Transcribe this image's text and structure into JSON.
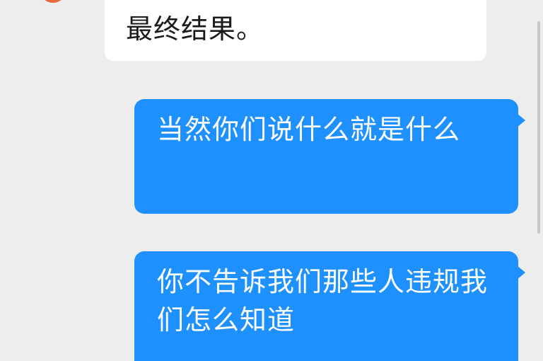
{
  "messages": [
    {
      "direction": "incoming",
      "text": "最终结果。"
    },
    {
      "direction": "outgoing",
      "text": "当然你们说什么就是什么"
    },
    {
      "direction": "outgoing",
      "text": "你不告诉我们那些人违规我们怎么知道"
    }
  ],
  "colors": {
    "background": "#ededed",
    "incoming_bubble": "#ffffff",
    "outgoing_bubble": "#1e90ff",
    "outgoing_text": "#ffffff"
  }
}
